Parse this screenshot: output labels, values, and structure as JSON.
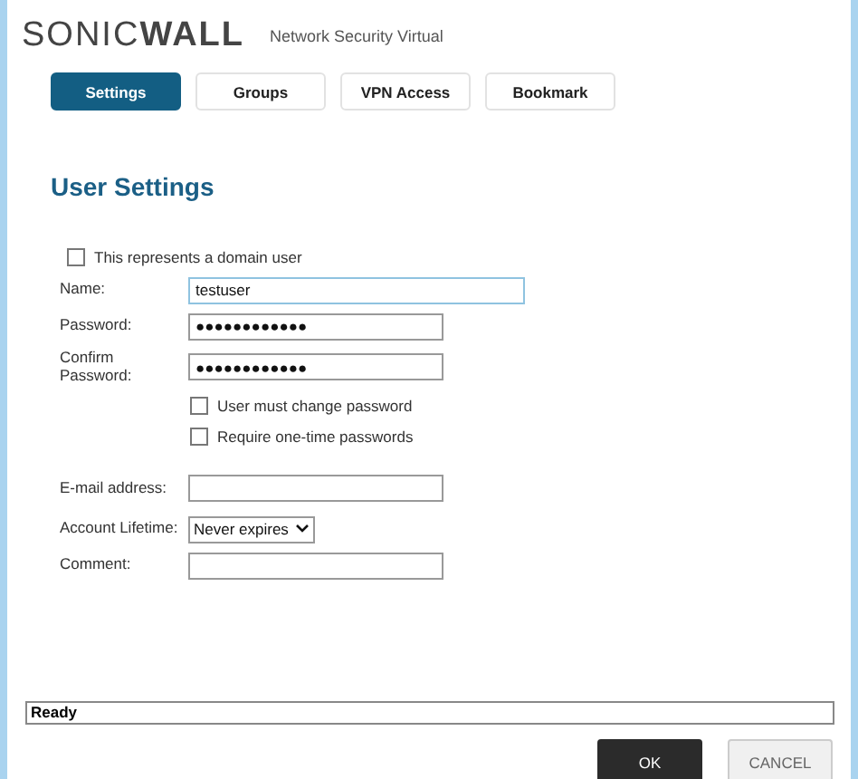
{
  "header": {
    "logo": "SONIC**WALL**",
    "product": "Network Security Virtual"
  },
  "tabs": [
    {
      "label": "Settings",
      "selected": true
    },
    {
      "label": "Groups",
      "selected": false
    },
    {
      "label": "VPN Access",
      "selected": false
    },
    {
      "label": "Bookmark",
      "selected": false
    }
  ],
  "heading": "User Settings",
  "form": [
    {
      "kind": "checkbox",
      "label": "This represents a domain user",
      "checked": false,
      "indent": false
    },
    {
      "kind": "text",
      "label": "Name:",
      "value": "testuser",
      "focused": true
    },
    {
      "kind": "text",
      "label": "Password:",
      "value": "●●●●●●●●●●●●",
      "focused": false
    },
    {
      "kind": "text",
      "label": "Confirm Password:",
      "value": "●●●●●●●●●●●●",
      "focused": false
    },
    {
      "kind": "checkbox",
      "label": "User must change password",
      "checked": false,
      "indent": true
    },
    {
      "kind": "checkbox",
      "label": "Require one-time passwords",
      "checked": false,
      "indent": true
    },
    {
      "kind": "gap"
    },
    {
      "kind": "text",
      "label": "E-mail address:",
      "focused": false
    },
    {
      "kind": "select",
      "label": "Account Lifetime:",
      "value": "Never expires"
    },
    {
      "kind": "text",
      "label": "Comment:",
      "focused": false
    }
  ],
  "status_bar": "Ready",
  "buttons": [
    {
      "label": "OK",
      "kind": "primary"
    },
    {
      "label": "CANCEL",
      "kind": "secondary"
    }
  ]
}
